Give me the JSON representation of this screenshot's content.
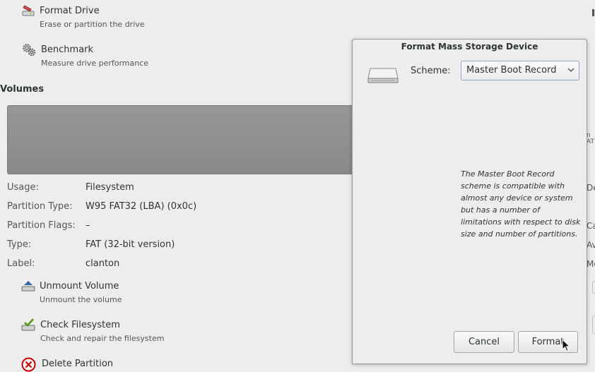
{
  "actions_top": {
    "format_drive": {
      "title": "Format Drive",
      "subtitle": "Erase or partition the drive"
    },
    "benchmark": {
      "title": "Benchmark",
      "subtitle": "Measure drive performance"
    }
  },
  "volumes": {
    "heading": "Volumes",
    "clipped_right_labels": [
      "n",
      "AT"
    ]
  },
  "properties": [
    {
      "label": "Usage:",
      "value": "Filesystem"
    },
    {
      "label": "Partition Type:",
      "value": "W95 FAT32 (LBA) (0x0c)"
    },
    {
      "label": "Partition Flags:",
      "value": "–"
    },
    {
      "label": "Type:",
      "value": "FAT (32-bit version)"
    },
    {
      "label": "Label:",
      "value": "clanton"
    }
  ],
  "right_clipped_text": [
    "De",
    "Ca",
    "Av",
    "Mo"
  ],
  "actions_bottom": {
    "unmount": {
      "title": "Unmount Volume",
      "subtitle": "Unmount the volume"
    },
    "check": {
      "title": "Check Filesystem",
      "subtitle": "Check and repair the filesystem"
    },
    "delete": {
      "title": "Delete Partition"
    }
  },
  "dialog": {
    "title": "Format Mass Storage Device",
    "scheme_label": "Scheme:",
    "scheme_value": "Master Boot Record",
    "description": "The Master Boot Record scheme is compatible with almost any device or system but has a number of limitations with respect to disk size and number of partitions.",
    "cancel_label": "Cancel",
    "format_label": "Format"
  }
}
